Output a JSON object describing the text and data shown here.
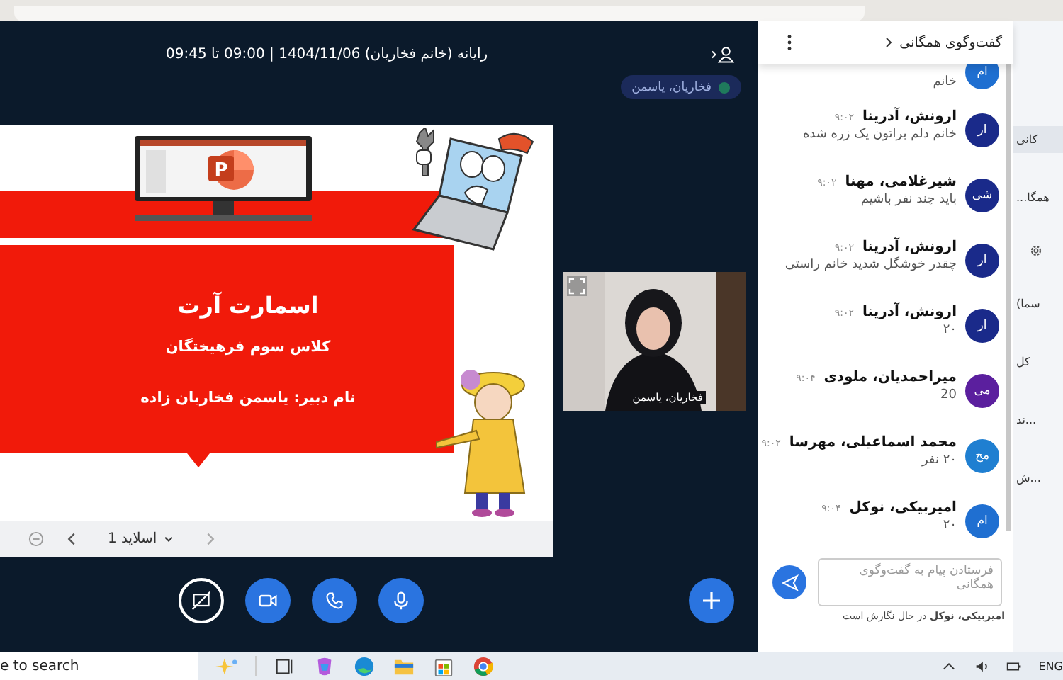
{
  "header": {
    "title": "رایانه (خانم فخاریان) 1404/11/06 | 09:00 تا 09:45",
    "talking": "فخاریان، یاسمن"
  },
  "slide": {
    "logo_letter": "P",
    "title": "اسمارت آرت",
    "subtitle": "کلاس سوم فرهیختگان",
    "teacher": "نام دبیر: یاسمن فخاریان زاده",
    "slide_label": "اسلاید 1"
  },
  "video": {
    "name": "فخاریان، یاسمن"
  },
  "controls": [
    {
      "kind": "screenshare"
    },
    {
      "kind": "camera"
    },
    {
      "kind": "phone"
    },
    {
      "kind": "mic"
    }
  ],
  "chat": {
    "title": "گفت‌وگوی همگانی",
    "messages": [
      {
        "initials": "ام",
        "color": "#1f6fd1",
        "text": "خانم"
      },
      {
        "initials": "ار",
        "color": "#1a2a8a",
        "name": "ارونش، آدرینا",
        "time": "۹:۰۲",
        "text": "خانم دلم براتون یک زره شده"
      },
      {
        "initials": "شی",
        "color": "#1a2a8a",
        "name": "شیرغلامی، مهنا",
        "time": "۹:۰۲",
        "text": "باید چند نفر باشیم"
      },
      {
        "initials": "ار",
        "color": "#1a2a8a",
        "name": "ارونش، آدرینا",
        "time": "۹:۰۲",
        "text": "چقدر خوشگل شدید خانم راستی"
      },
      {
        "initials": "ار",
        "color": "#1a2a8a",
        "name": "ارونش، آدرینا",
        "time": "۹:۰۲",
        "text": "۲۰"
      },
      {
        "initials": "می",
        "color": "#5b1f9e",
        "name": "میراحمدیان، ملودی",
        "time": "۹:۰۴",
        "text": "20"
      },
      {
        "initials": "مح",
        "color": "#1f7fd1",
        "name": "محمد اسماعیلی، مهرسا",
        "time": "۹:۰۲",
        "text": "۲۰ نفر"
      },
      {
        "initials": "ام",
        "color": "#1f6fd1",
        "name": "امیربیکی، نوکل",
        "time": "۹:۰۴",
        "text": "۲۰"
      }
    ],
    "placeholder": "فرستادن پیام به گفت‌وگوی همگانی",
    "typing": "**امیربیکی، نوکل** در حال نگارش است"
  },
  "side_panel": {
    "items": [
      {
        "kind": "text",
        "label": "کانی",
        "selected": true
      },
      {
        "kind": "text",
        "label": "همگا...",
        "selected": false
      },
      {
        "kind": "gear"
      },
      {
        "kind": "text",
        "label": "سما)",
        "selected": false
      },
      {
        "kind": "text",
        "label": "کل",
        "selected": false
      },
      {
        "kind": "text",
        "label": "...ند",
        "selected": false
      },
      {
        "kind": "text",
        "label": "...ش",
        "selected": false
      }
    ]
  },
  "taskbar": {
    "search": "e to search",
    "language": "ENG"
  }
}
